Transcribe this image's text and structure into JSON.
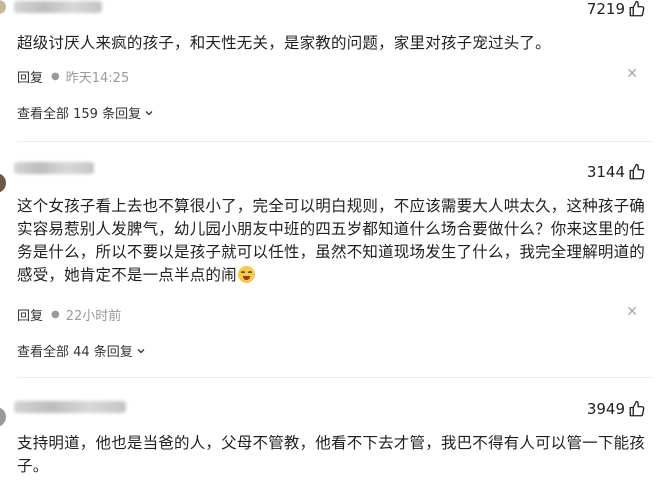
{
  "icons": {
    "like": "thumbs-up-icon",
    "close": "close-icon",
    "expand": "chevron-down-icon"
  },
  "colors": {
    "text": "#1f1f1f",
    "muted": "#9a9a9a",
    "divider": "#eeeeee",
    "emoji": "#f7c948"
  },
  "comments": [
    {
      "likes": "7219",
      "text": "超级讨厌人来疯的孩子，和天性无关，是家教的问题，家里对孩子宠过头了。",
      "reply_label": "回复",
      "time": "昨天14:25",
      "view_all": "查看全部 159 条回复"
    },
    {
      "likes": "3144",
      "text": "这个女孩子看上去也不算很小了，完全可以明白规则，不应该需要大人哄太久，这种孩子确实容易惹别人发脾气，幼儿园小朋友中班的四五岁都知道什么场合要做什么？你来这里的任务是什么，所以不要以是孩子就可以任性，虽然不知道现场发生了什么，我完全理解明道的感受，她肯定不是一点半点的闹",
      "reply_label": "回复",
      "time": "22小时前",
      "view_all": "查看全部 44 条回复"
    },
    {
      "likes": "3949",
      "text": "支持明道，他也是当爸的人，父母不管教，他看不下去才管，我巴不得有人可以管一下能孩子。"
    }
  ]
}
